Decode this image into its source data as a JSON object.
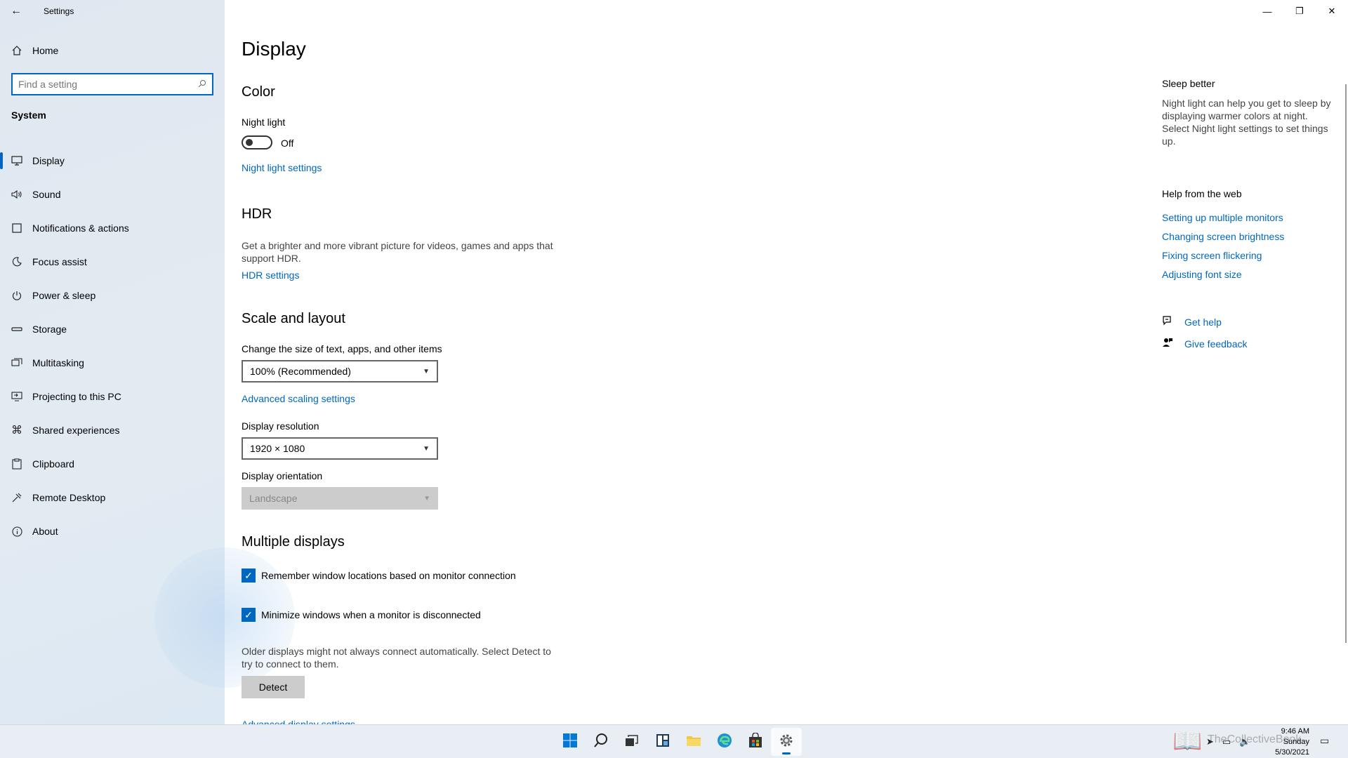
{
  "window": {
    "title": "Settings",
    "back_glyph": "←",
    "minimize_glyph": "—",
    "restore_glyph": "❐",
    "close_glyph": "✕"
  },
  "sidebar": {
    "home_label": "Home",
    "search_placeholder": "Find a setting",
    "group_label": "System",
    "items": [
      {
        "label": "Display",
        "icon": "monitor-icon",
        "selected": true
      },
      {
        "label": "Sound",
        "icon": "speaker-icon"
      },
      {
        "label": "Notifications & actions",
        "icon": "notification-icon"
      },
      {
        "label": "Focus assist",
        "icon": "moon-icon"
      },
      {
        "label": "Power & sleep",
        "icon": "power-icon"
      },
      {
        "label": "Storage",
        "icon": "drive-icon"
      },
      {
        "label": "Multitasking",
        "icon": "multitask-icon"
      },
      {
        "label": "Projecting to this PC",
        "icon": "project-icon"
      },
      {
        "label": "Shared experiences",
        "icon": "share-icon"
      },
      {
        "label": "Clipboard",
        "icon": "clipboard-icon"
      },
      {
        "label": "Remote Desktop",
        "icon": "remote-icon"
      },
      {
        "label": "About",
        "icon": "info-icon"
      }
    ]
  },
  "main": {
    "title": "Display",
    "color": {
      "heading": "Color",
      "night_light_label": "Night light",
      "night_light_state": "Off",
      "night_light_on": false,
      "night_light_link": "Night light settings"
    },
    "hdr": {
      "heading": "HDR",
      "description": "Get a brighter and more vibrant picture for videos, games and apps that support HDR.",
      "link": "HDR settings"
    },
    "scale": {
      "heading": "Scale and layout",
      "size_label": "Change the size of text, apps, and other items",
      "size_value": "100% (Recommended)",
      "advanced_link": "Advanced scaling settings",
      "resolution_label": "Display resolution",
      "resolution_value": "1920 × 1080",
      "orientation_label": "Display orientation",
      "orientation_value": "Landscape"
    },
    "multiple": {
      "heading": "Multiple displays",
      "check1": "Remember window locations based on monitor connection",
      "check2": "Minimize windows when a monitor is disconnected",
      "note": "Older displays might not always connect automatically. Select Detect to try to connect to them.",
      "detect_button": "Detect",
      "advanced_link": "Advanced display settings"
    }
  },
  "right": {
    "sleep_heading": "Sleep better",
    "sleep_desc": "Night light can help you get to sleep by displaying warmer colors at night. Select Night light settings to set things up.",
    "help_heading": "Help from the web",
    "links": [
      "Setting up multiple monitors",
      "Changing screen brightness",
      "Fixing screen flickering",
      "Adjusting font size"
    ],
    "get_help": "Get help",
    "give_feedback": "Give feedback"
  },
  "taskbar": {
    "time": "9:46 AM",
    "day": "Sunday",
    "date": "5/30/2021",
    "watermark": "TheCollectiveBook",
    "accent": "#0067c0"
  }
}
